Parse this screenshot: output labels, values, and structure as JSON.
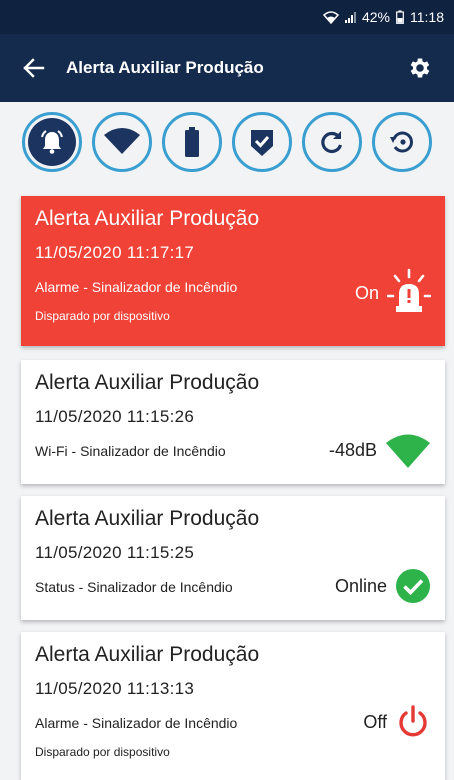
{
  "status_bar": {
    "battery": "42%",
    "time": "11:18"
  },
  "app_bar": {
    "title": "Alerta Auxiliar Produção"
  },
  "quick_actions": [
    {
      "icon": "bell-alarm-icon"
    },
    {
      "icon": "wifi-icon"
    },
    {
      "icon": "battery-icon"
    },
    {
      "icon": "shield-check-icon"
    },
    {
      "icon": "refresh-icon"
    },
    {
      "icon": "history-icon"
    }
  ],
  "events": [
    {
      "title": "Alerta Auxiliar Produção",
      "datetime": "11/05/2020  11:17:17",
      "label": "Alarme - Sinalizador de Incêndio",
      "sub": "Disparado por dispositivo",
      "value": "On",
      "icon": "siren-icon"
    },
    {
      "title": "Alerta Auxiliar Produção",
      "datetime": "11/05/2020  11:15:26",
      "label": "Wi-Fi - Sinalizador de Incêndio",
      "value": "-48dB",
      "icon": "wifi-signal-icon"
    },
    {
      "title": "Alerta Auxiliar Produção",
      "datetime": "11/05/2020  11:15:25",
      "label": "Status - Sinalizador de Incêndio",
      "value": "Online",
      "icon": "check-circle-icon"
    },
    {
      "title": "Alerta Auxiliar Produção",
      "datetime": "11/05/2020  11:13:13",
      "label": "Alarme - Sinalizador de Incêndio",
      "sub": "Disparado por dispositivo",
      "value": "Off",
      "icon": "power-icon"
    }
  ],
  "colors": {
    "header": "#152b4e",
    "accent": "#3a9fd0",
    "alarm": "#f04237",
    "ok": "#2db34a",
    "off": "#e53935"
  }
}
